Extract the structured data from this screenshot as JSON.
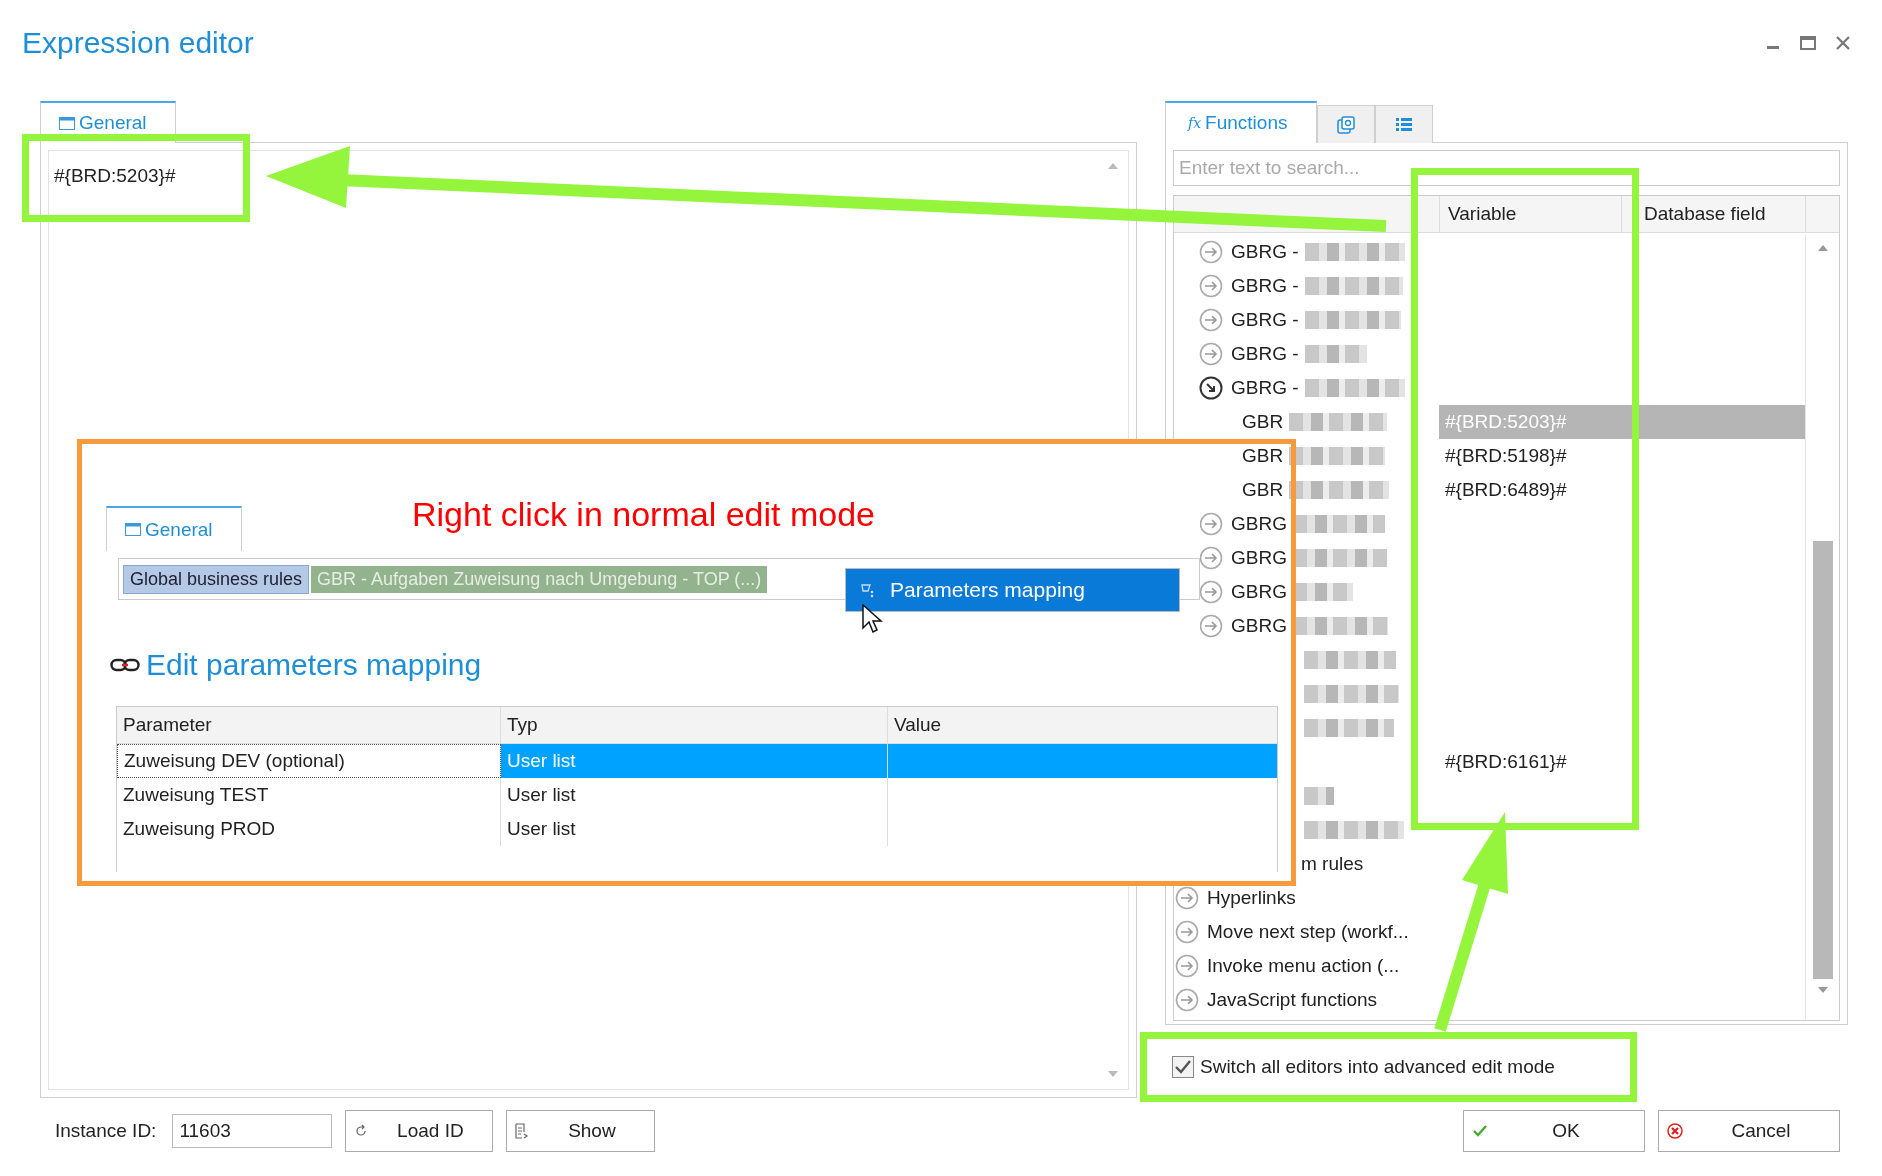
{
  "window": {
    "title": "Expression editor"
  },
  "editor": {
    "tab": {
      "label": "General",
      "selected": true
    },
    "value": "#{BRD:5203}#"
  },
  "functions_panel": {
    "tabs": [
      {
        "kind": "text",
        "glyph": "fx",
        "label": "Functions",
        "selected": true
      },
      {
        "kind": "at",
        "selected": false
      },
      {
        "kind": "list",
        "selected": false
      }
    ],
    "search": {
      "placeholder": "Enter text to search..."
    },
    "columns": [
      "Variable",
      "Database field"
    ],
    "tree": [
      {
        "children": [
          {
            "kind": "group",
            "label": "GBRG -",
            "expanded": false,
            "redacted": true,
            "selected": false
          },
          {
            "kind": "group",
            "label": "GBRG -",
            "expanded": false,
            "redacted": true,
            "selected": false
          },
          {
            "kind": "group",
            "label": "GBRG -",
            "expanded": false,
            "redacted": true,
            "selected": false
          },
          {
            "kind": "group",
            "label": "GBRG -",
            "expanded": false,
            "redacted": true,
            "selected": false
          },
          {
            "kind": "group",
            "label": "GBRG -",
            "expanded": true,
            "redacted": true,
            "selected": false,
            "children": [
              {
                "kind": "rule",
                "label": "GBR",
                "redacted": true,
                "variable": "#{BRD:5203}#",
                "selected": true
              },
              {
                "kind": "rule",
                "label": "GBR",
                "redacted": true,
                "variable": "#{BRD:5198}#",
                "selected": false
              },
              {
                "kind": "rule",
                "label": "GBR",
                "redacted": true,
                "variable": "#{BRD:6489}#",
                "selected": false
              }
            ]
          },
          {
            "kind": "group",
            "label": "GBRG",
            "expanded": false,
            "redacted": true,
            "selected": false
          },
          {
            "kind": "group",
            "label": "GBRG",
            "expanded": false,
            "redacted": true,
            "selected": false
          },
          {
            "kind": "group",
            "label": "GBRG",
            "expanded": false,
            "redacted": true,
            "selected": false
          },
          {
            "kind": "group",
            "label": "GBRG",
            "expanded": false,
            "redacted": true,
            "selected": false
          },
          {
            "kind": "covered",
            "redacted": true,
            "selected": false
          },
          {
            "kind": "covered",
            "redacted": true,
            "selected": false
          },
          {
            "kind": "covered",
            "redacted": true,
            "selected": false
          },
          {
            "kind": "covered",
            "variable": "#{BRD:6161}#",
            "selected": false
          },
          {
            "kind": "covered",
            "redacted": true,
            "selected": false
          },
          {
            "kind": "covered",
            "redacted": true,
            "selected": false
          }
        ]
      },
      {
        "kind": "clipped",
        "label": "m rules",
        "selected": false
      },
      {
        "kind": "group",
        "label": "Hyperlinks",
        "expanded": false,
        "selected": false
      },
      {
        "kind": "group",
        "label": "Move next step (workf...",
        "expanded": false,
        "selected": false
      },
      {
        "kind": "group",
        "label": "Invoke menu action (...",
        "expanded": false,
        "selected": false
      },
      {
        "kind": "group",
        "label": "JavaScript functions",
        "expanded": false,
        "selected": false
      }
    ]
  },
  "advanced_mode": {
    "label": "Switch all editors into advanced edit mode",
    "checked": true
  },
  "footer": {
    "instance_label": "Instance ID:",
    "instance_value": "11603",
    "buttons": [
      {
        "kind": "load",
        "label": "Load ID"
      },
      {
        "kind": "show",
        "label": "Show"
      }
    ],
    "dialog_buttons": [
      {
        "kind": "ok",
        "label": "OK"
      },
      {
        "kind": "cancel",
        "label": "Cancel"
      }
    ]
  },
  "inset": {
    "caption": "Right click in normal edit mode",
    "tab": {
      "label": "General",
      "selected": true
    },
    "tokens": [
      {
        "kind": "category",
        "text": "Global business rules"
      },
      {
        "kind": "rule",
        "text": "GBR - Aufgaben Zuweisung nach Umgebung - TOP (...)"
      }
    ],
    "context_menu": [
      {
        "label": "Parameters mapping",
        "selected": true
      }
    ],
    "dialog": {
      "title": "Edit parameters mapping",
      "columns": [
        "Parameter",
        "Typ",
        "Value"
      ],
      "rows": [
        {
          "parameter": "Zuweisung DEV (optional)",
          "type": "User list",
          "selected": true
        },
        {
          "parameter": "Zuweisung TEST",
          "type": "User list",
          "selected": false
        },
        {
          "parameter": "Zuweisung PROD",
          "type": "User list",
          "selected": false
        }
      ]
    }
  }
}
